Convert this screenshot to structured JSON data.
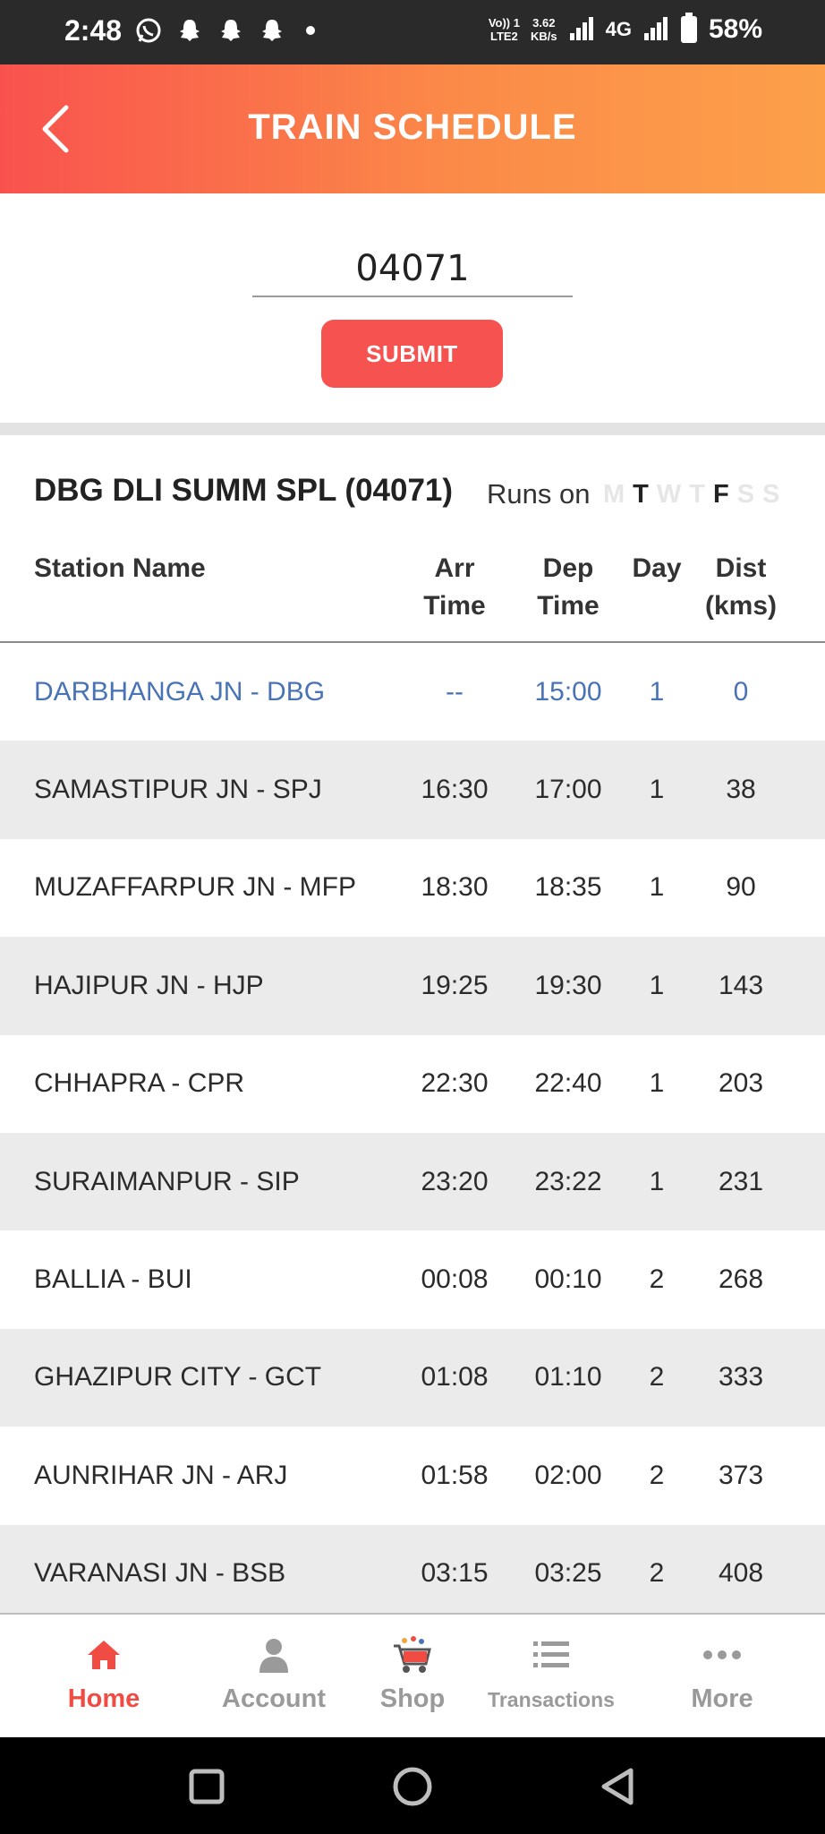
{
  "status_bar": {
    "time": "2:48",
    "left_icons": [
      "whatsapp-icon",
      "snapchat-icon",
      "snapchat-icon",
      "snapchat-icon"
    ],
    "volte_line1": "Vo)) 1",
    "volte_line2": "LTE2",
    "speed_value": "3.62",
    "speed_unit": "KB/s",
    "network": "4G",
    "battery": "58%"
  },
  "header": {
    "title": "TRAIN SCHEDULE",
    "gradient_start": "#f9524e",
    "gradient_end": "#fca04a"
  },
  "search": {
    "value": "04071",
    "button_label": "SUBMIT",
    "button_color": "#f65350"
  },
  "train": {
    "name": "DBG DLI SUMM SPL (04071)",
    "runs_on_label": "Runs on",
    "days": [
      {
        "letter": "M",
        "runs": false
      },
      {
        "letter": "T",
        "runs": true
      },
      {
        "letter": "W",
        "runs": false
      },
      {
        "letter": "T",
        "runs": false
      },
      {
        "letter": "F",
        "runs": true
      },
      {
        "letter": "S",
        "runs": false
      },
      {
        "letter": "S",
        "runs": false
      }
    ]
  },
  "table": {
    "headers": {
      "station": "Station Name",
      "arr_1": "Arr",
      "arr_2": "Time",
      "dep_1": "Dep",
      "dep_2": "Time",
      "day": "Day",
      "dist_1": "Dist",
      "dist_2": "(kms)"
    },
    "rows": [
      {
        "station": "DARBHANGA JN - DBG",
        "arr": "--",
        "dep": "15:00",
        "day": "1",
        "dist": "0"
      },
      {
        "station": "SAMASTIPUR JN - SPJ",
        "arr": "16:30",
        "dep": "17:00",
        "day": "1",
        "dist": "38"
      },
      {
        "station": "MUZAFFARPUR JN - MFP",
        "arr": "18:30",
        "dep": "18:35",
        "day": "1",
        "dist": "90"
      },
      {
        "station": "HAJIPUR JN - HJP",
        "arr": "19:25",
        "dep": "19:30",
        "day": "1",
        "dist": "143"
      },
      {
        "station": "CHHAPRA - CPR",
        "arr": "22:30",
        "dep": "22:40",
        "day": "1",
        "dist": "203"
      },
      {
        "station": "SURAIMANPUR - SIP",
        "arr": "23:20",
        "dep": "23:22",
        "day": "1",
        "dist": "231"
      },
      {
        "station": "BALLIA - BUI",
        "arr": "00:08",
        "dep": "00:10",
        "day": "2",
        "dist": "268"
      },
      {
        "station": "GHAZIPUR CITY - GCT",
        "arr": "01:08",
        "dep": "01:10",
        "day": "2",
        "dist": "333"
      },
      {
        "station": "AUNRIHAR JN - ARJ",
        "arr": "01:58",
        "dep": "02:00",
        "day": "2",
        "dist": "373"
      },
      {
        "station": "VARANASI JN - BSB",
        "arr": "03:15",
        "dep": "03:25",
        "day": "2",
        "dist": "408"
      }
    ]
  },
  "bottom_nav": [
    {
      "label": "Home",
      "icon": "home-icon",
      "active": true
    },
    {
      "label": "Account",
      "icon": "account-icon",
      "active": false
    },
    {
      "label": "Shop",
      "icon": "shopping-cart-icon",
      "active": false
    },
    {
      "label": "Transactions",
      "icon": "list-icon",
      "active": false
    },
    {
      "label": "More",
      "icon": "more-dots-icon",
      "active": false
    }
  ],
  "system_nav": [
    "recents-icon",
    "home-circle-icon",
    "back-triangle-icon"
  ]
}
